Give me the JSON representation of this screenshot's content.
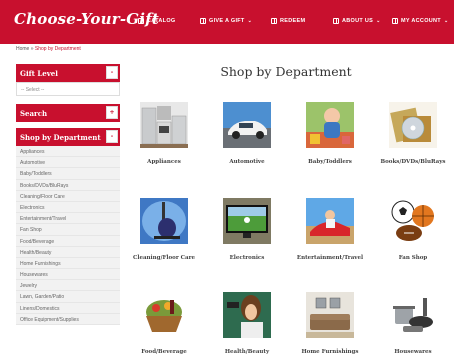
{
  "header": {
    "logo": "Choose-Your-Gift",
    "nav": [
      {
        "label": "CATALOG"
      },
      {
        "label": "GIVE A GIFT",
        "caret": "⌄"
      },
      {
        "label": "REDEEM"
      },
      {
        "label": "ABOUT US",
        "caret": "⌄"
      },
      {
        "label": "MY ACCOUNT",
        "caret": "⌄"
      }
    ]
  },
  "breadcrumb": {
    "home": "Home",
    "sep": "»",
    "current": "Shop by Department"
  },
  "sidebar": {
    "gift_level": {
      "title": "Gift Level",
      "toggle": "-",
      "select_value": "-- Select --"
    },
    "search": {
      "title": "Search",
      "toggle": "+"
    },
    "departments": {
      "title": "Shop by Department",
      "toggle": "-",
      "items": [
        "Appliances",
        "Automotive",
        "Baby/Toddlers",
        "Books/DVDs/BluRays",
        "Cleaning/Floor Care",
        "Electronics",
        "Entertainment/Travel",
        "Fan Shop",
        "Food/Beverage",
        "Health/Beauty",
        "Home Furnishings",
        "Housewares",
        "Jewelry",
        "Lawn, Garden/Patio",
        "Linens/Domestics",
        "Office Equipment/Supplies"
      ]
    }
  },
  "main": {
    "title": "Shop by Department",
    "tiles": [
      {
        "label": "Appliances",
        "icon": "appliances-image"
      },
      {
        "label": "Automotive",
        "icon": "car-image"
      },
      {
        "label": "Baby/Toddlers",
        "icon": "baby-image"
      },
      {
        "label": "Books/DVDs/BluRays",
        "icon": "books-dvds-image"
      },
      {
        "label": "Cleaning/Floor Care",
        "icon": "vacuum-image"
      },
      {
        "label": "Electronics",
        "icon": "tv-image"
      },
      {
        "label": "Entertainment/Travel",
        "icon": "travel-image"
      },
      {
        "label": "Fan Shop",
        "icon": "sports-balls-image"
      },
      {
        "label": "Food/Beverage",
        "icon": "gift-basket-image"
      },
      {
        "label": "Health/Beauty",
        "icon": "hair-dryer-image"
      },
      {
        "label": "Home Furnishings",
        "icon": "living-room-image"
      },
      {
        "label": "Housewares",
        "icon": "cookware-image"
      }
    ]
  },
  "colors": {
    "brand": "#c8102e",
    "sidebar_bg": "#f2f2f2"
  }
}
